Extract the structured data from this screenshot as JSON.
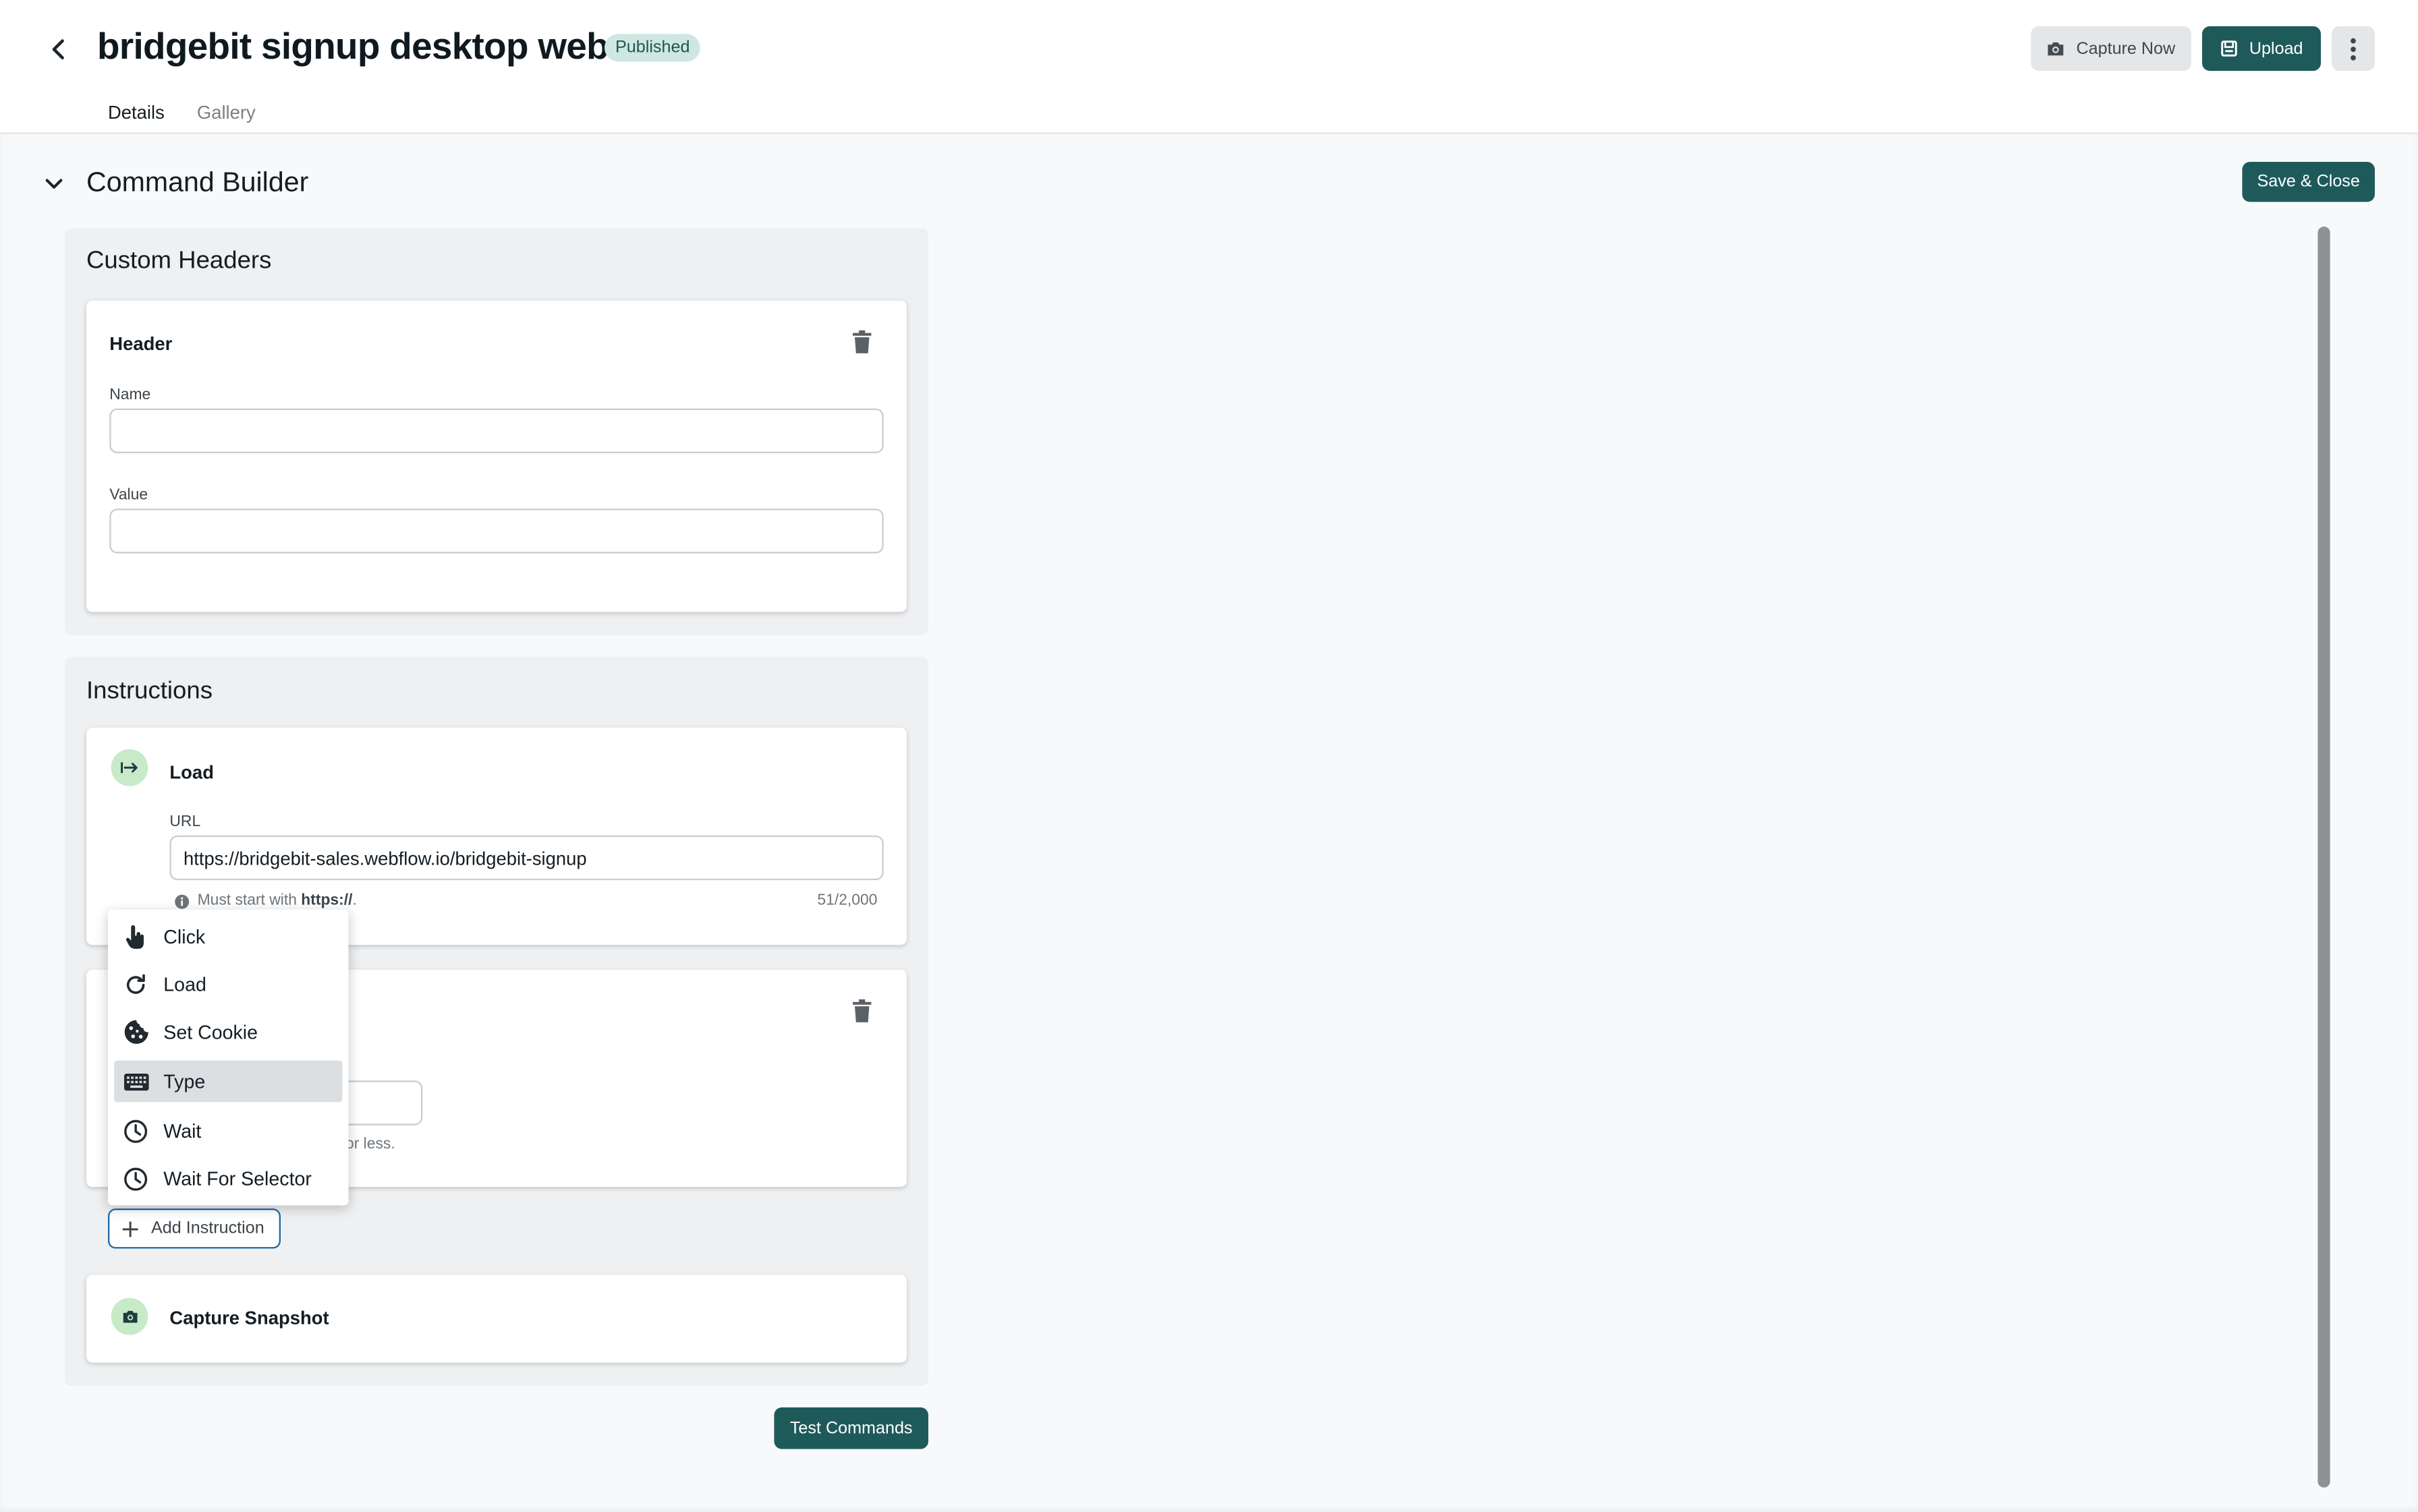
{
  "header": {
    "title": "bridgebit signup desktop web",
    "status": "Published",
    "capture_label": "Capture Now",
    "upload_label": "Upload",
    "tabs": [
      {
        "label": "Details",
        "active": true
      },
      {
        "label": "Gallery",
        "active": false
      }
    ]
  },
  "builder": {
    "title": "Command Builder",
    "save_label": "Save & Close",
    "headers_panel": {
      "title": "Custom Headers",
      "card_title": "Header",
      "name_label": "Name",
      "name_value": "",
      "value_label": "Value",
      "value_value": ""
    },
    "instructions_panel": {
      "title": "Instructions",
      "load_card": {
        "title": "Load",
        "url_label": "URL",
        "url_value": "https://bridgebit-sales.webflow.io/bridgebit-signup",
        "help_prefix": "Must start with",
        "help_bold": "https://",
        "help_suffix": ".",
        "char_count": "51/2,000"
      },
      "second_card": {
        "help_partial": "or less."
      },
      "add_label": "Add Instruction",
      "snapshot_title": "Capture Snapshot"
    },
    "test_label": "Test Commands"
  },
  "menu": {
    "selected": "Type",
    "items": [
      {
        "label": "Click",
        "icon": "pointer-hand-icon"
      },
      {
        "label": "Load",
        "icon": "reload-icon"
      },
      {
        "label": "Set Cookie",
        "icon": "cookie-icon"
      },
      {
        "label": "Type",
        "icon": "keyboard-icon"
      },
      {
        "label": "Wait",
        "icon": "clock-icon"
      },
      {
        "label": "Wait For Selector",
        "icon": "clock-icon"
      }
    ]
  },
  "colors": {
    "primary": "#1f5a5b",
    "badge_bg": "#cfe7e2",
    "icon_bg": "#c7eac9",
    "focus_border": "#1d6aa8"
  }
}
